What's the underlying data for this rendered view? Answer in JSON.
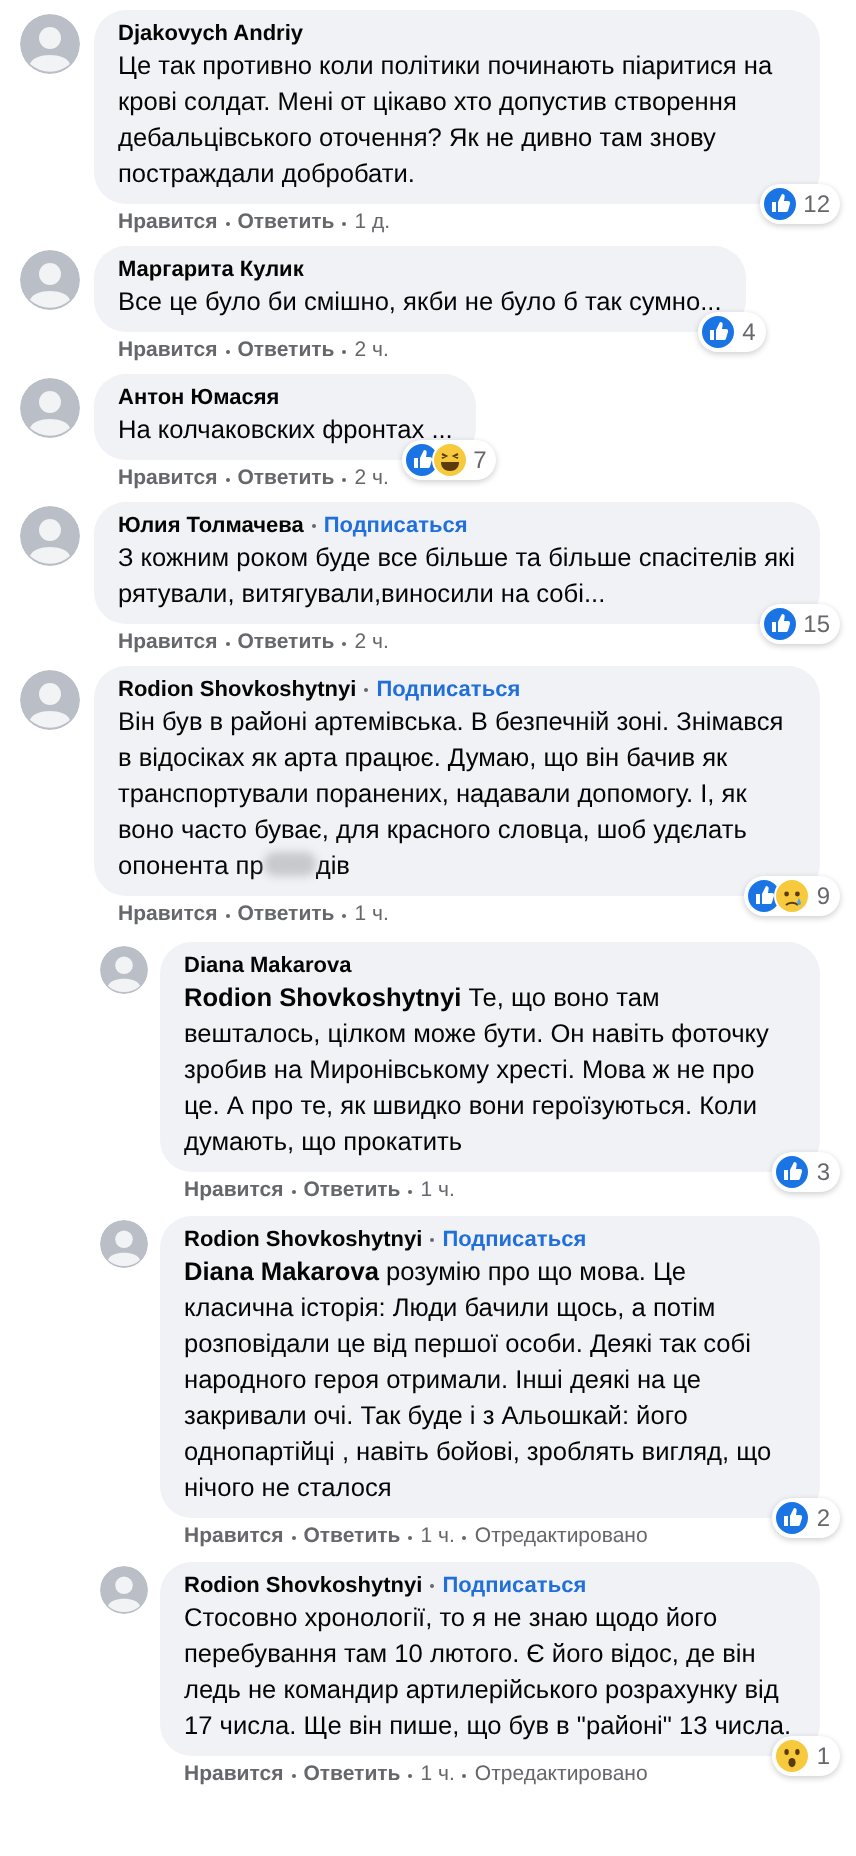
{
  "comments": [
    {
      "author": "Djakovych Andriy",
      "text": "Це так противно коли політики починають піаритися на крові солдат. Мені от цікаво хто допустив створення дебальцівського оточення? Як не дивно там знову постраждали добробати.",
      "reactions": [
        {
          "kind": "like"
        }
      ],
      "reaction_count": "12",
      "actions": {
        "like": "Нравится",
        "reply": "Ответить",
        "time": "1 д."
      }
    },
    {
      "author": "Маргарита Кулик",
      "text": "Все це було би смішно, якби не було б так сумно...",
      "reactions": [
        {
          "kind": "like"
        }
      ],
      "reaction_count": "4",
      "actions": {
        "like": "Нравится",
        "reply": "Ответить",
        "time": "2 ч."
      }
    },
    {
      "author": "Антон Юмасяя",
      "text": "На колчаковских фронтах ...",
      "reactions": [
        {
          "kind": "like"
        },
        {
          "kind": "haha"
        }
      ],
      "reaction_count": "7",
      "actions": {
        "like": "Нравится",
        "reply": "Ответить",
        "time": "2 ч."
      }
    },
    {
      "author": "Юлия Толмачева",
      "follow": "Подписаться",
      "text": "З кожним роком буде все більше та більше спасітелів які рятували, витягували,виносили на собі...",
      "reactions": [
        {
          "kind": "like"
        }
      ],
      "reaction_count": "15",
      "actions": {
        "like": "Нравится",
        "reply": "Ответить",
        "time": "2 ч."
      }
    },
    {
      "author": "Rodion Shovkoshytnyi",
      "follow": "Подписаться",
      "text": "Він був в районі артемівська. В безпечній зоні. Знімався в відосіках як арта працює. Думаю, що він бачив як транспортували поранених, надавали допомогу. І, як воно часто буває, для красного словца, шоб удєлать опонента пр",
      "text_after_blur": "дів",
      "reactions": [
        {
          "kind": "like"
        },
        {
          "kind": "sad"
        }
      ],
      "reaction_count": "9",
      "actions": {
        "like": "Нравится",
        "reply": "Ответить",
        "time": "1 ч."
      },
      "replies": [
        {
          "author": "Diana Makarova",
          "text": "**Rodion Shovkoshytnyi** Те, що воно там вешталось, цілком може бути. Он навіть фоточку зробив на Миронівському хресті. Мова ж не про це. А про те, як швидко вони героїзуються. Коли думають, що прокатить",
          "reactions": [
            {
              "kind": "like"
            }
          ],
          "reaction_count": "3",
          "actions": {
            "like": "Нравится",
            "reply": "Ответить",
            "time": "1 ч."
          }
        },
        {
          "author": "Rodion Shovkoshytnyi",
          "follow": "Подписаться",
          "text": "**Diana Makarova** розумію про що мова. Це класична історія: Люди бачили щось, а потім розповідали це від першої особи. Деякі так собі народного героя отримали. Інші деякі на це закривали очі. Так буде і з Альошкай: його однопартійці , навіть бойові, зроблять вигляд, що нічого не сталося",
          "reactions": [
            {
              "kind": "like"
            }
          ],
          "reaction_count": "2",
          "actions": {
            "like": "Нравится",
            "reply": "Ответить",
            "time": "1 ч.",
            "edited": "Отредактировано"
          }
        },
        {
          "author": "Rodion Shovkoshytnyi",
          "follow": "Подписаться",
          "text": "Стосовно хронології, то я не знаю щодо його перебування там 10 лютого. Є його відос, де він ледь не командир артилерійського розрахунку від 17 числа. Ще він пише, що був в \"районі\" 13 числа.",
          "reactions": [
            {
              "kind": "wow"
            }
          ],
          "reaction_count": "1",
          "actions": {
            "like": "Нравится",
            "reply": "Ответить",
            "time": "1 ч.",
            "edited": "Отредактировано"
          }
        }
      ]
    }
  ]
}
